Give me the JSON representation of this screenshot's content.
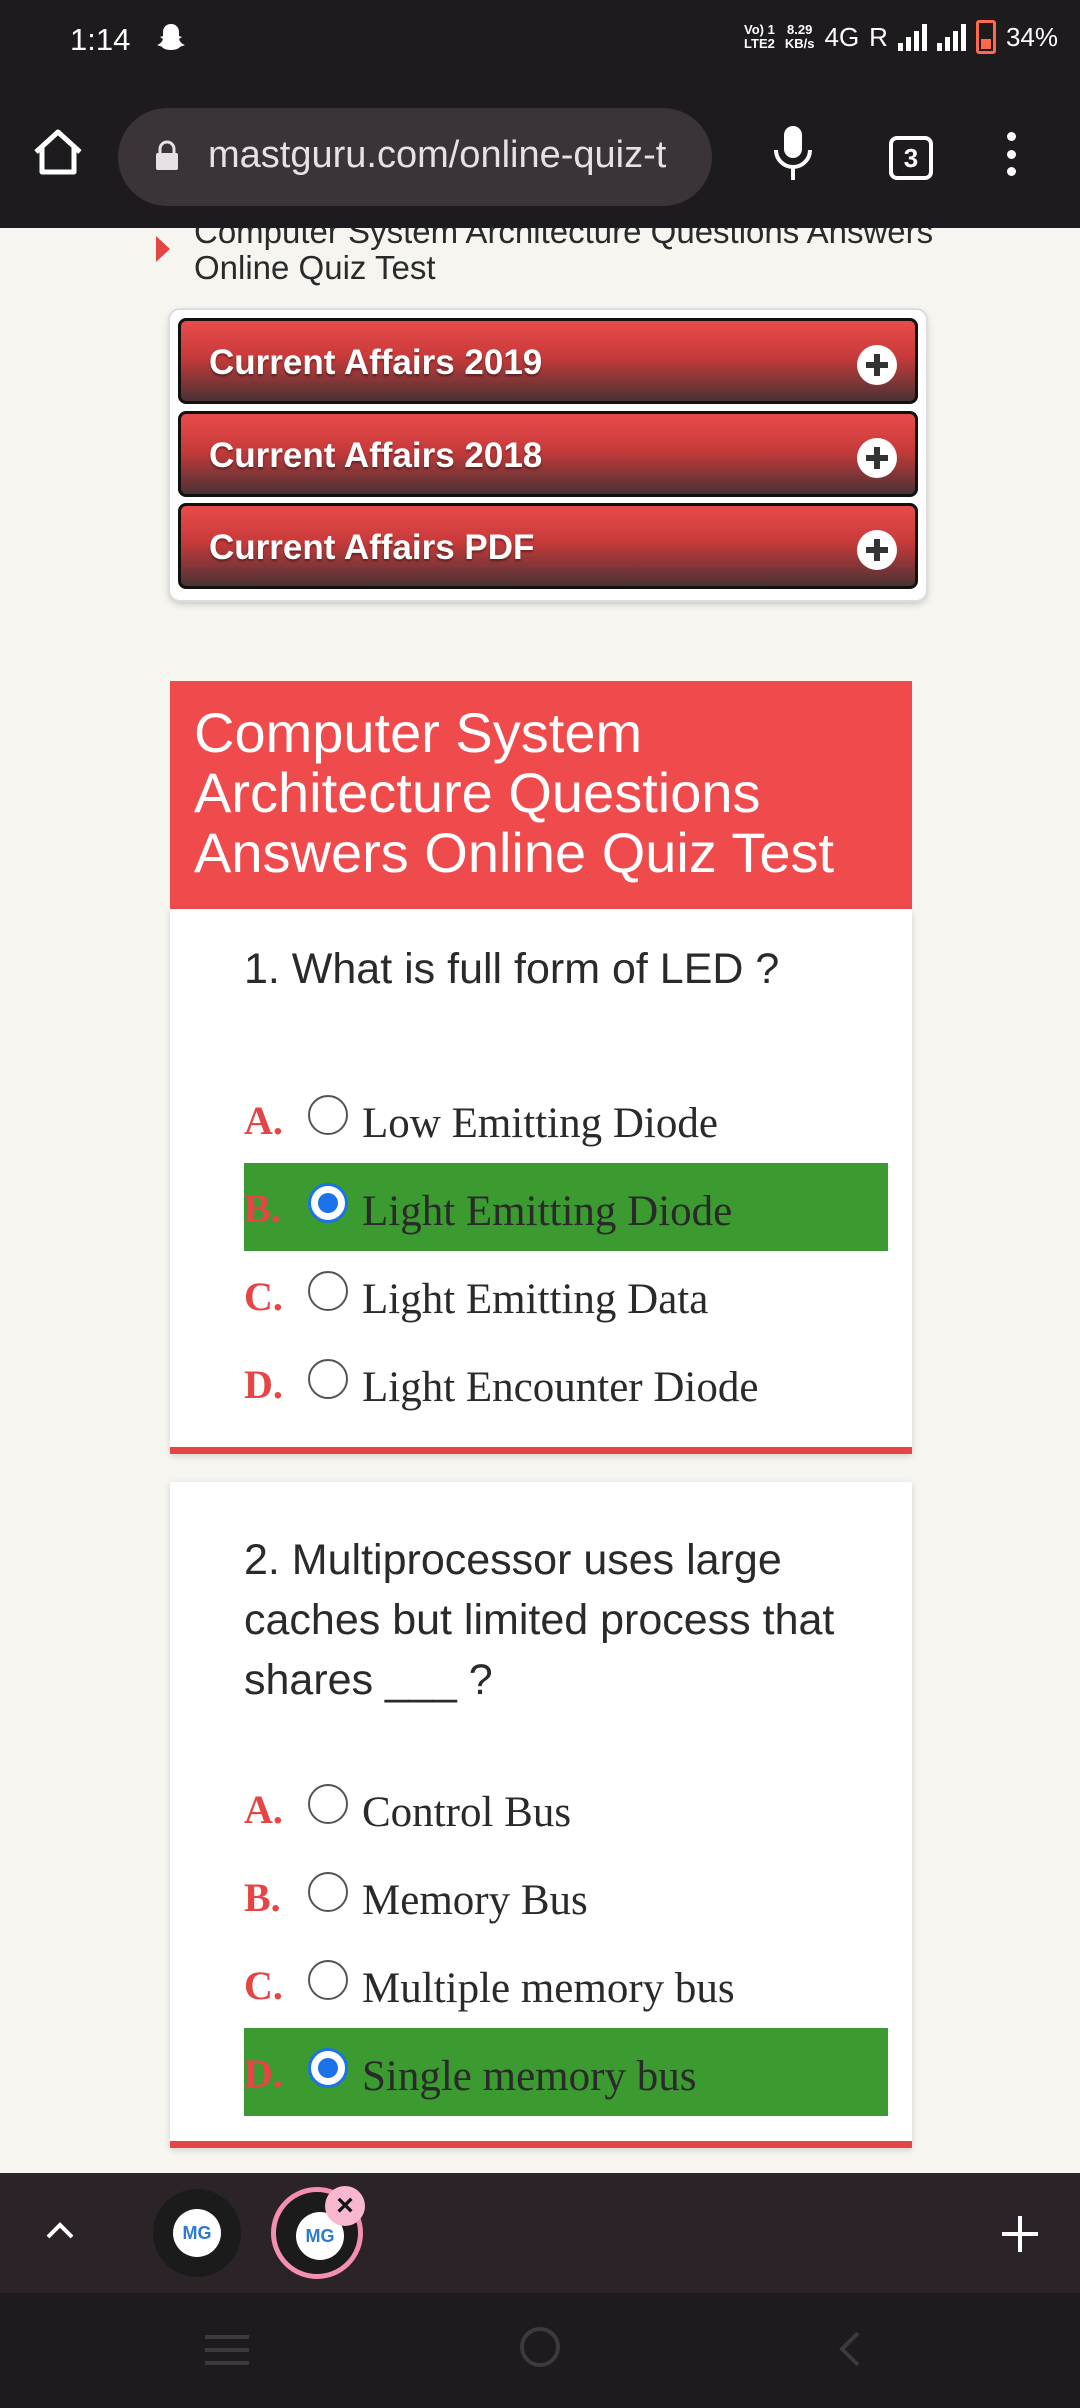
{
  "status_bar": {
    "time": "1:14",
    "network_line1": "Vo) 1",
    "network_line2": "LTE2",
    "speed_value": "8.29",
    "speed_unit": "KB/s",
    "network_type": "4G",
    "roaming": "R",
    "battery": "34%",
    "battery_color": "#ff6a4d"
  },
  "browser": {
    "url": "mastguru.com/online-quiz-t",
    "tab_count": "3"
  },
  "page": {
    "breadcrumb_text": "Computer System Architecture Questions Answers Online Quiz Test",
    "accordion": [
      {
        "label": "Current Affairs 2019"
      },
      {
        "label": "Current Affairs 2018"
      },
      {
        "label": "Current Affairs PDF"
      }
    ],
    "quiz_title": "Computer System Architecture Questions Answers Online Quiz Test",
    "accent_color": "#ef4a4c",
    "correct_color": "#3b9a30",
    "questions": [
      {
        "text": "1. What is full form of LED ?",
        "options": [
          {
            "letter": "A.",
            "text": "Low Emitting Diode"
          },
          {
            "letter": "B.",
            "text": "Light Emitting Diode"
          },
          {
            "letter": "C.",
            "text": "Light Emitting Data"
          },
          {
            "letter": "D.",
            "text": "Light Encounter Diode"
          }
        ],
        "selected": "B."
      },
      {
        "text": "2. Multiprocessor uses large caches but limited process that shares ___ ?",
        "options": [
          {
            "letter": "A.",
            "text": "Control Bus"
          },
          {
            "letter": "B.",
            "text": "Memory Bus"
          },
          {
            "letter": "C.",
            "text": "Multiple memory bus"
          },
          {
            "letter": "D.",
            "text": "Single memory bus"
          }
        ],
        "selected": "D."
      }
    ]
  },
  "tab_strip": {
    "tabs": [
      {
        "favicon_text": "MG"
      },
      {
        "favicon_text": "MG"
      }
    ],
    "close_symbol": "×"
  }
}
